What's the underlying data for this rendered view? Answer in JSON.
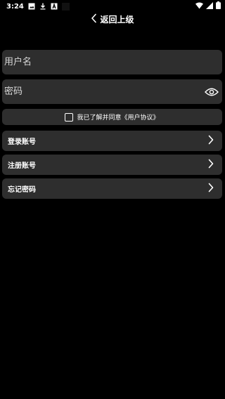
{
  "status_bar": {
    "time": "3:24",
    "icons_left": [
      "image-icon",
      "download-icon",
      "a-box-icon",
      "black-square-icon"
    ],
    "icons_right": [
      "wifi-icon",
      "signal-icon",
      "battery-icon"
    ]
  },
  "nav": {
    "back_label": "返回上级"
  },
  "form": {
    "username_placeholder": "用户名",
    "password_placeholder": "密码",
    "agreement_text": "我已了解并同意《用户协议》"
  },
  "menu": {
    "items": [
      {
        "label": "登录账号"
      },
      {
        "label": "注册账号"
      },
      {
        "label": "忘记密码"
      }
    ]
  },
  "colors": {
    "background": "#000000",
    "panel": "#2e2e2e",
    "text": "#ffffff"
  }
}
